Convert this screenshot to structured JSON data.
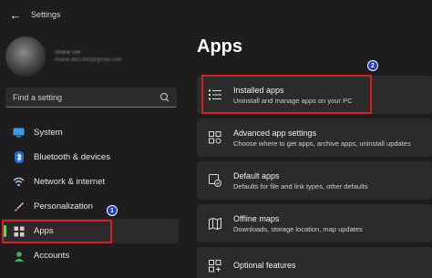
{
  "window": {
    "title": "Settings"
  },
  "profile": {
    "name": "Shane Der",
    "email": "shane.der1993@gmail.com"
  },
  "search": {
    "placeholder": "Find a setting"
  },
  "nav": {
    "items": [
      {
        "label": "System",
        "icon": "monitor-icon"
      },
      {
        "label": "Bluetooth & devices",
        "icon": "bluetooth-icon"
      },
      {
        "label": "Network & internet",
        "icon": "wifi-icon"
      },
      {
        "label": "Personalization",
        "icon": "paintbrush-icon"
      },
      {
        "label": "Apps",
        "icon": "apps-icon",
        "active": true
      },
      {
        "label": "Accounts",
        "icon": "person-icon"
      }
    ]
  },
  "main": {
    "title": "Apps",
    "cards": [
      {
        "title": "Installed apps",
        "subtitle": "Uninstall and manage apps on your PC",
        "icon": "list-icon"
      },
      {
        "title": "Advanced app settings",
        "subtitle": "Choose where to get apps, archive apps, uninstall updates",
        "icon": "app-settings-icon"
      },
      {
        "title": "Default apps",
        "subtitle": "Defaults for file and link types, other defaults",
        "icon": "default-apps-icon"
      },
      {
        "title": "Offline maps",
        "subtitle": "Downloads, storage location, map updates",
        "icon": "map-icon"
      },
      {
        "title": "Optional features",
        "subtitle": "",
        "icon": "features-icon"
      }
    ]
  },
  "annotations": {
    "step1": "1",
    "step2": "2",
    "highlight_color": "#d81e1e",
    "badge_color": "#1a3fc0"
  },
  "colors": {
    "accent": "#6ad06a"
  }
}
